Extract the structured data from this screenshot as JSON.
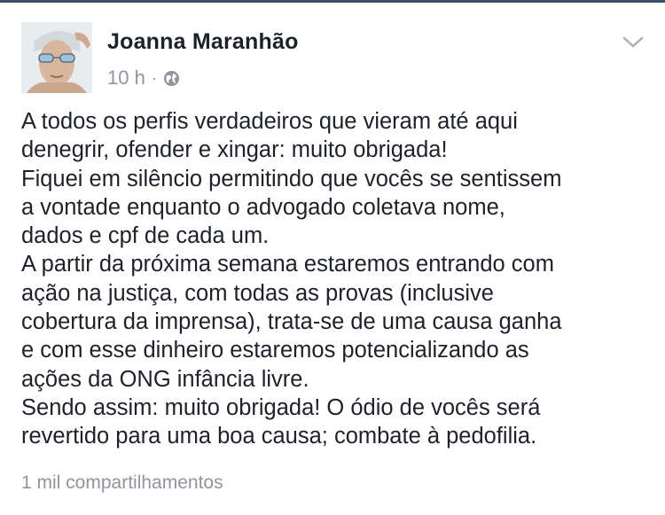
{
  "post": {
    "author": "Joanna Maranhão",
    "time": "10 h",
    "separator": "·",
    "privacy_icon": "globe-icon",
    "menu_icon": "chevron-down-icon",
    "avatar_icon": "profile-photo",
    "text_lines": [
      "A todos os perfis verdadeiros que vieram até aqui",
      "denegrir, ofender e xingar: muito obrigada!",
      "Fiquei em silêncio permitindo que vocês se sentissem",
      "a vontade enquanto o advogado coletava nome,",
      "dados e cpf de cada um.",
      "A partir da próxima semana estaremos entrando com",
      "ação na justiça, com todas as provas (inclusive",
      "cobertura da imprensa), trata-se de uma causa ganha",
      "e com esse dinheiro estaremos potencializando as",
      "ações da ONG infância livre.",
      "Sendo assim: muito obrigada! O ódio de vocês será",
      "revertido para uma boa causa; combate à pedofilia."
    ],
    "shares": "1 mil compartilhamentos"
  },
  "colors": {
    "primary_text": "#1d2129",
    "secondary_text": "#90949c",
    "top_rule": "#3b4f6b"
  }
}
